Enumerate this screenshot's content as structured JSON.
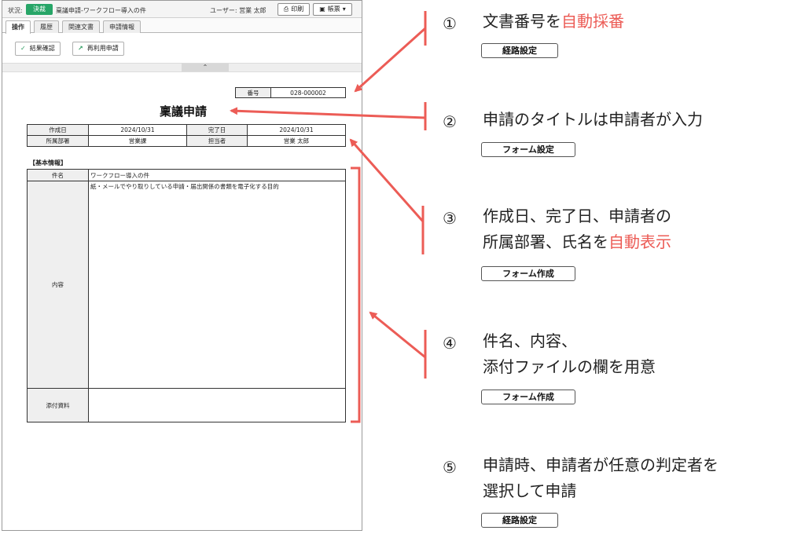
{
  "topbar": {
    "status_label": "状況:",
    "status_badge": "決裁",
    "doc_title": "稟議申請-ワークフロー導入の件",
    "user": "ユーザー: 営業 太郎",
    "print_label": "印刷",
    "form_label": "帳票",
    "badge_color": "#27a567"
  },
  "tabs": [
    {
      "label": "操作",
      "active": true
    },
    {
      "label": "履歴"
    },
    {
      "label": "関連文書"
    },
    {
      "label": "申請情報"
    }
  ],
  "actions": {
    "confirm_label": "結果確認",
    "reuse_label": "再利用申請"
  },
  "form": {
    "number_label": "番号",
    "number_value": "028-000002",
    "title": "稟議申請",
    "created_label": "作成日",
    "created_value": "2024/10/31",
    "completed_label": "完了日",
    "completed_value": "2024/10/31",
    "dept_label": "所属部署",
    "dept_value": "営業課",
    "owner_label": "担当者",
    "owner_value": "営業 太郎",
    "section_label": "【基本情報】",
    "subject_label": "件名",
    "subject_value": "ワークフロー導入の件",
    "content_label": "内容",
    "content_value": "紙・メールでやり取りしている申請・届出関係の書類を電子化する目的",
    "attach_label": "添付資料"
  },
  "annotations": {
    "accent_color": "#ec5c56",
    "items": [
      {
        "num": "①",
        "text_a": "文書番号を",
        "text_red": "自動採番",
        "tag": "経路設定"
      },
      {
        "num": "②",
        "text_a": "申請のタイトルは申請者が入力",
        "tag": "フォーム設定"
      },
      {
        "num": "③",
        "line1": "作成日、完了日、申請者の",
        "line2_a": "所属部署、氏名を",
        "line2_red": "自動表示",
        "tag": "フォーム作成"
      },
      {
        "num": "④",
        "line1": "件名、内容、",
        "line2": "添付ファイルの欄を用意",
        "tag": "フォーム作成"
      },
      {
        "num": "⑤",
        "line1": "申請時、申請者が任意の判定者を",
        "line2": "選択して申請",
        "tag": "経路設定"
      }
    ]
  }
}
